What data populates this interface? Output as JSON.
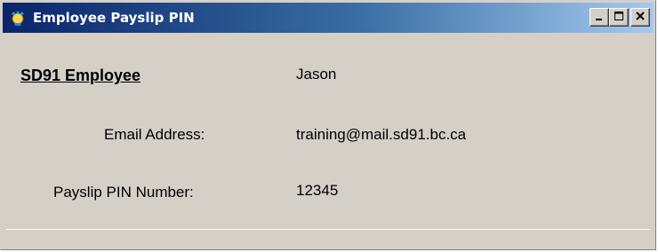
{
  "window": {
    "title": "Employee Payslip PIN",
    "icon": "app-crown-icon"
  },
  "title_buttons": {
    "minimize": "minimize-icon",
    "maximize": "maximize-icon",
    "close": "close-icon"
  },
  "form": {
    "heading": "SD91 Employee",
    "employee_name": "Jason",
    "email_label": "Email Address:",
    "email_value": "training@mail.sd91.bc.ca",
    "pin_label": "Payslip PIN Number:",
    "pin_value": "12345"
  },
  "colors": {
    "titlebar_start": "#0a246a",
    "titlebar_end": "#a6caf0",
    "window_bg": "#d4d0c8"
  }
}
